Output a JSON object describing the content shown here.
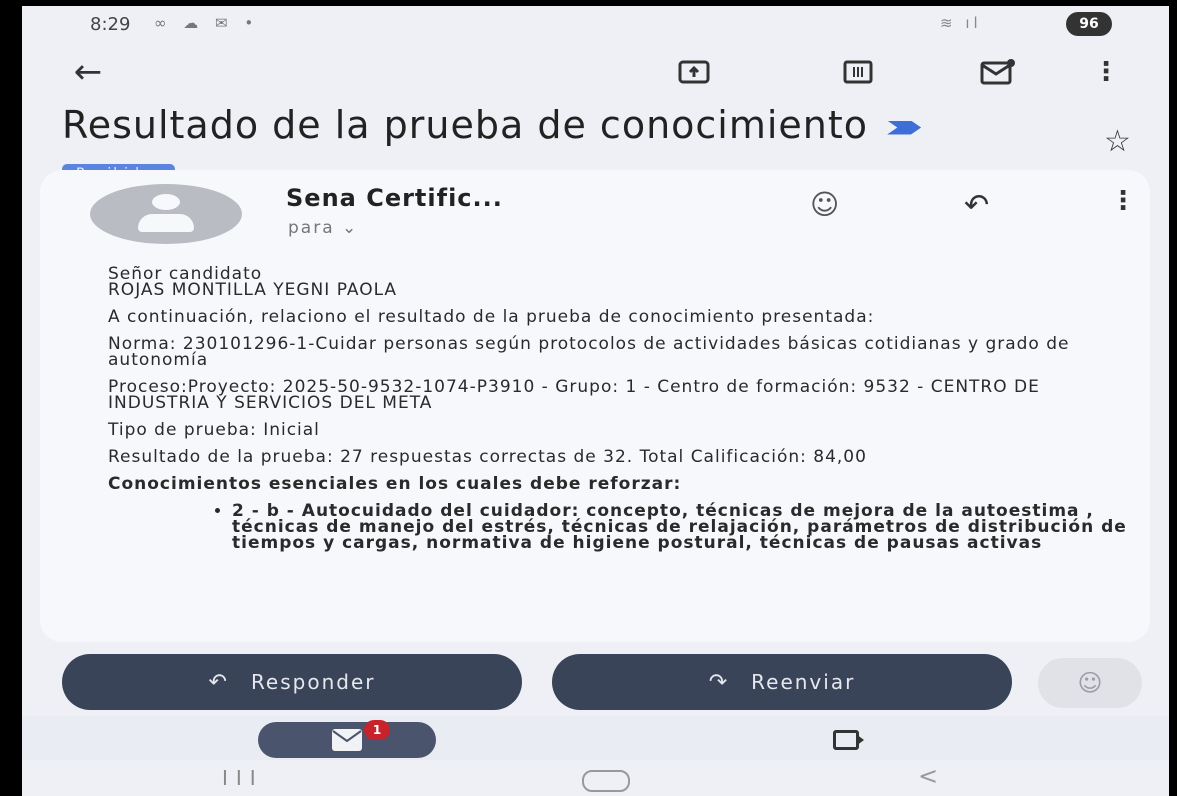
{
  "status_bar": {
    "time": "8:29",
    "left_icons": "∞ ☁ ✉ •",
    "right_icons": "≋ ıl",
    "battery": "96"
  },
  "toolbar": {
    "back": "←",
    "more": "⋮"
  },
  "email": {
    "subject": "Resultado de la prueba de conocimiento",
    "label": "Recibidos",
    "star": "☆",
    "sender": "Sena Certific...",
    "recipient": "para  ⌄",
    "emoji": "☺",
    "reply_icon": "↶",
    "more": "⋮",
    "body": {
      "greeting": "Señor candidato",
      "candidate_name": "ROJAS MONTILLA YEGNI PAOLA",
      "intro": "A continuación, relaciono el resultado de la prueba de conocimiento presentada:",
      "norma": "Norma: 230101296-1-Cuidar personas según protocolos de actividades básicas cotidianas y grado de autonomía",
      "proceso": "Proceso:Proyecto: 2025-50-9532-1074-P3910 - Grupo: 1 - Centro de formación: 9532 - CENTRO DE INDUSTRIA Y SERVICIOS DEL META",
      "tipo": "Tipo de prueba: Inicial",
      "resultado": "Resultado de la prueba: 27 respuestas correctas de 32. Total Calificación: 84,00",
      "reinforce_heading": "Conocimientos esenciales en los cuales debe reforzar:",
      "topics": [
        "2 - b - Autocuidado del cuidador: concepto, técnicas de mejora de la autoestima , técnicas de manejo del estrés, técnicas de relajación, parámetros de distribución de tiempos y cargas, normativa de higiene postural, técnicas de pausas activas"
      ]
    }
  },
  "actions": {
    "reply_icon": "↶",
    "reply": "Responder",
    "forward_icon": "↷",
    "forward": "Reenviar",
    "react": "☺"
  },
  "bottom_nav": {
    "mail_badge": "1"
  },
  "system_nav": {
    "recents": "III",
    "back": "<"
  }
}
